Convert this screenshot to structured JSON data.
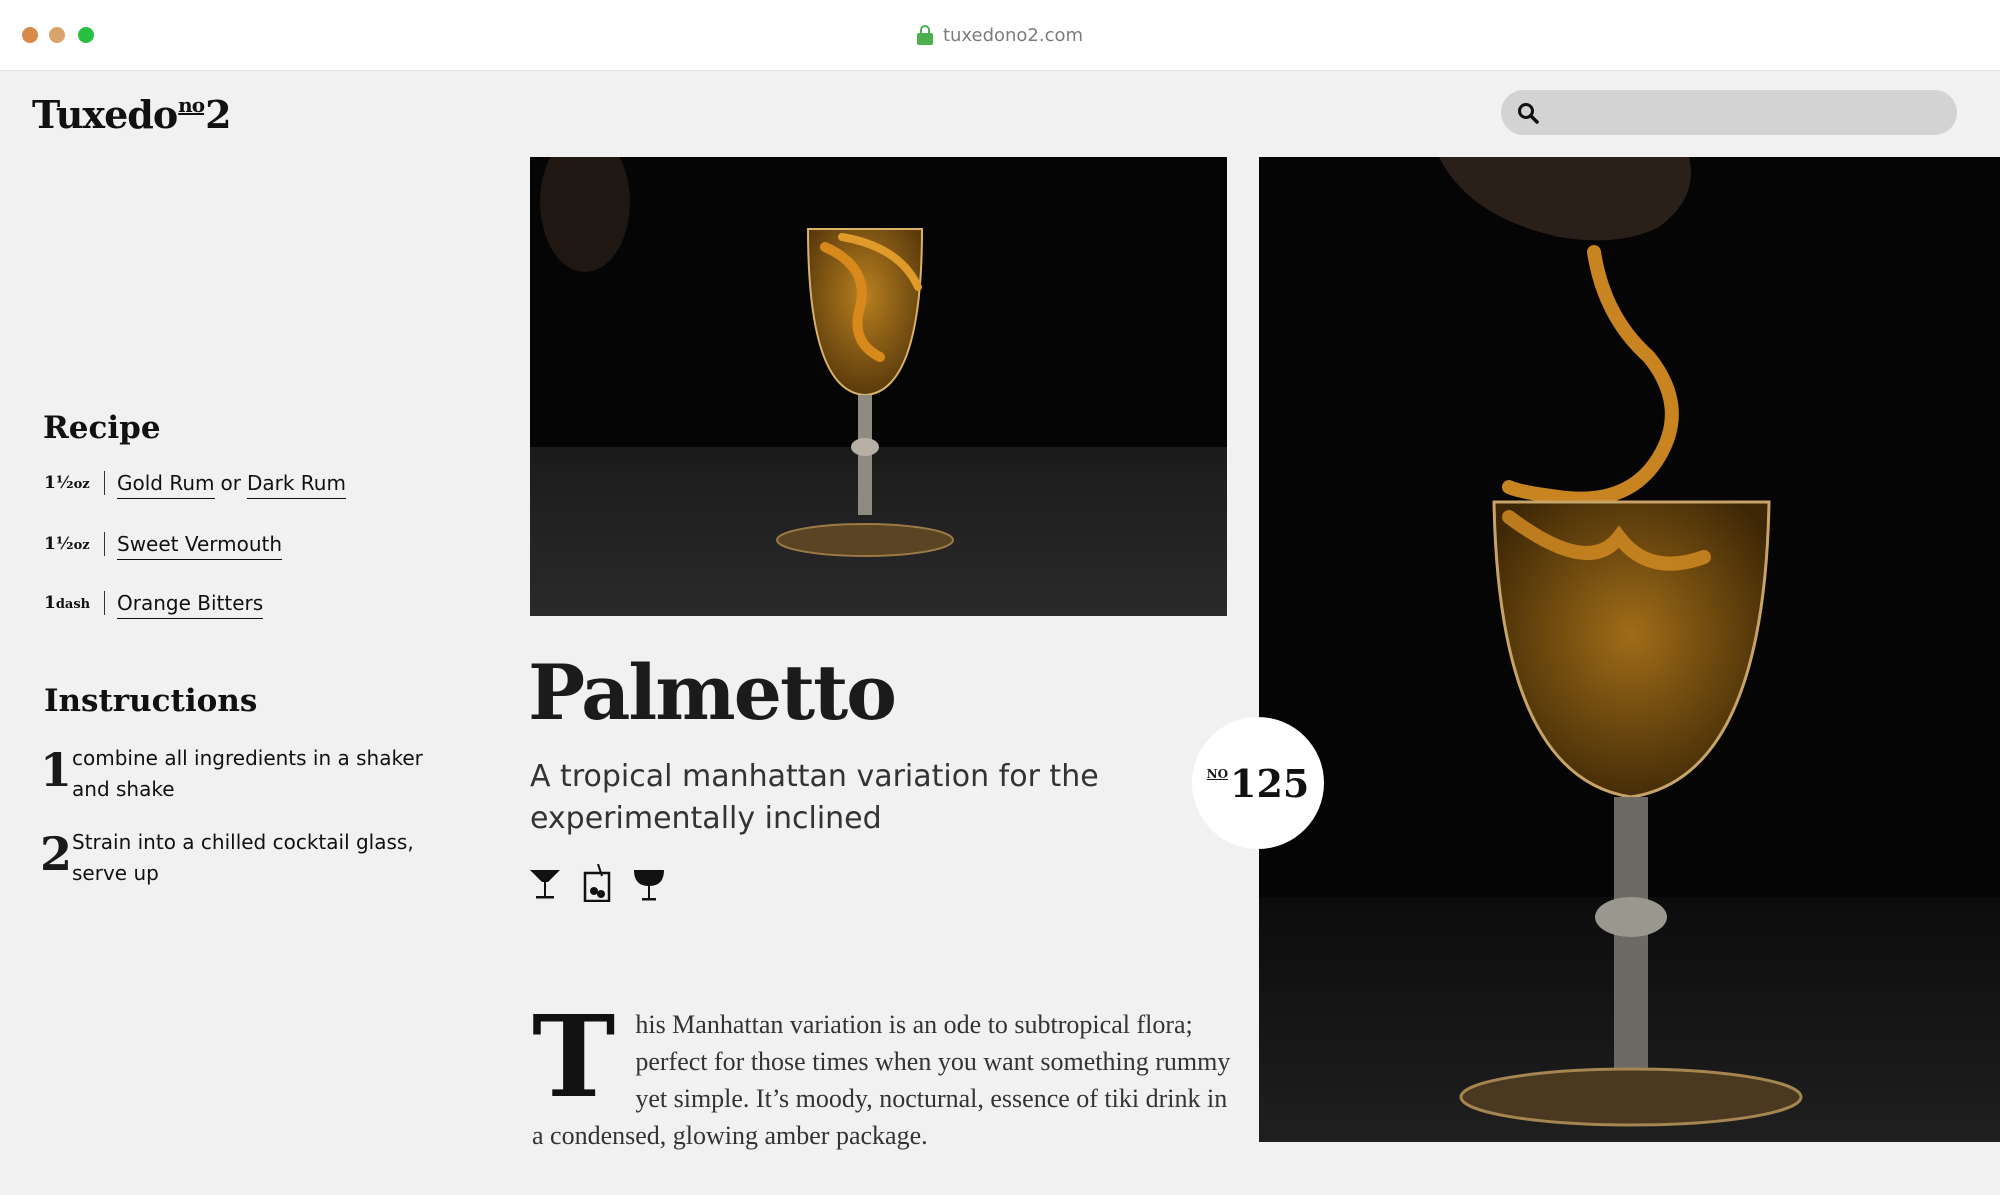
{
  "browser": {
    "url": "tuxedono2.com"
  },
  "header": {
    "logo_main": "Tuxedo",
    "logo_sup": "no",
    "logo_num": "2",
    "search_placeholder": ""
  },
  "recipe": {
    "heading": "Recipe",
    "ingredients": [
      {
        "amount": "1½",
        "unit": "oz",
        "names": [
          "Gold Rum",
          "Dark Rum"
        ],
        "joiner": "or"
      },
      {
        "amount": "1½",
        "unit": "oz",
        "names": [
          "Sweet Vermouth"
        ]
      },
      {
        "amount": "1",
        "unit": "dash",
        "names": [
          "Orange Bitters"
        ]
      }
    ]
  },
  "instructions": {
    "heading": "Instructions",
    "steps": [
      {
        "num": "1",
        "text": "combine all ingredients in a shaker and shake"
      },
      {
        "num": "2",
        "text": "Strain into a chilled cocktail glass, serve up"
      }
    ]
  },
  "drink": {
    "name": "Palmetto",
    "tagline": "A tropical manhattan variation for the experimentally inclined",
    "number_prefix": "NO",
    "number": "125",
    "glass_icons": [
      "cocktail-glass-icon",
      "shaker-glass-icon",
      "coupe-glass-icon"
    ],
    "dropcap": "T",
    "description": "his Manhattan variation is an ode to subtropical flora; perfect for those times when you want something rummy yet simple. It’s moody, nocturnal, essence of tiki drink in a condensed, glowing amber package."
  },
  "colors": {
    "page_bg": "#f1f1f1",
    "photo_bg": "#050505",
    "amber": "#c8871f",
    "search_bg": "#d3d3d3"
  }
}
